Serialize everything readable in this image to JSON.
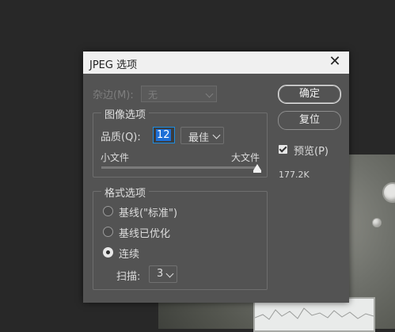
{
  "dialog": {
    "title": "JPEG 选项",
    "close_icon": "close-icon"
  },
  "matte": {
    "label": "杂边(M):",
    "value": "无"
  },
  "image_options": {
    "group_title": "图像选项",
    "quality_label": "品质(Q):",
    "quality_value": "12",
    "quality_preset": "最佳",
    "small_file_label": "小文件",
    "large_file_label": "大文件",
    "slider_level": 1.0
  },
  "format_options": {
    "group_title": "格式选项",
    "options": [
      {
        "label": "基线(\"标准\")",
        "checked": false
      },
      {
        "label": "基线已优化",
        "checked": false
      },
      {
        "label": "连续",
        "checked": true
      }
    ],
    "scan_label": "扫描:",
    "scan_value": "3"
  },
  "buttons": {
    "ok": "确定",
    "reset": "复位"
  },
  "preview": {
    "label": "预览(P)",
    "checked": true,
    "file_size": "177.2K"
  }
}
